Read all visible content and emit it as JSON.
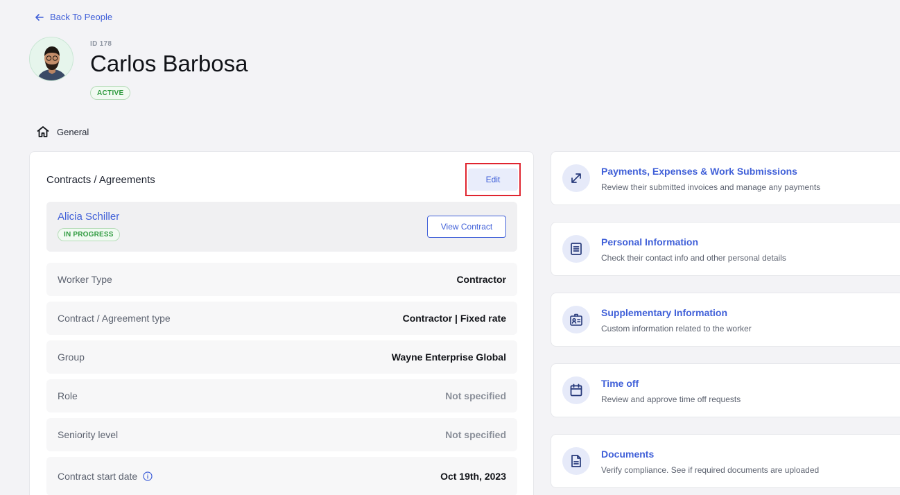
{
  "nav": {
    "back_label": "Back To People"
  },
  "person": {
    "id_label": "ID 178",
    "name": "Carlos Barbosa",
    "status": "ACTIVE"
  },
  "tabs": {
    "general": "General"
  },
  "contracts": {
    "title": "Contracts / Agreements",
    "edit_label": "Edit",
    "contract": {
      "name": "Alicia Schiller",
      "status": "IN PROGRESS",
      "view_label": "View Contract"
    },
    "rows": [
      {
        "label": "Worker Type",
        "value": "Contractor"
      },
      {
        "label": "Contract / Agreement type",
        "value": "Contractor | Fixed rate"
      },
      {
        "label": "Group",
        "value": "Wayne Enterprise Global"
      },
      {
        "label": "Role",
        "value": "Not specified"
      },
      {
        "label": "Seniority level",
        "value": "Not specified"
      },
      {
        "label": "Contract start date",
        "value": "Oct 19th, 2023"
      }
    ]
  },
  "sections": [
    {
      "title": "Payments, Expenses & Work Submissions",
      "desc": "Review their submitted invoices and manage any payments",
      "icon": "arrows-diagonal-icon"
    },
    {
      "title": "Personal Information",
      "desc": "Check their contact info and other personal details",
      "icon": "document-list-icon"
    },
    {
      "title": "Supplementary Information",
      "desc": "Custom information related to the worker",
      "icon": "id-badge-icon"
    },
    {
      "title": "Time off",
      "desc": "Review and approve time off requests",
      "icon": "calendar-icon"
    },
    {
      "title": "Documents",
      "desc": "Verify compliance. See if required documents are uploaded",
      "icon": "file-icon"
    }
  ],
  "colors": {
    "accent": "#3f5fd8",
    "success": "#2e9a3e",
    "highlight": "#e0242f"
  }
}
